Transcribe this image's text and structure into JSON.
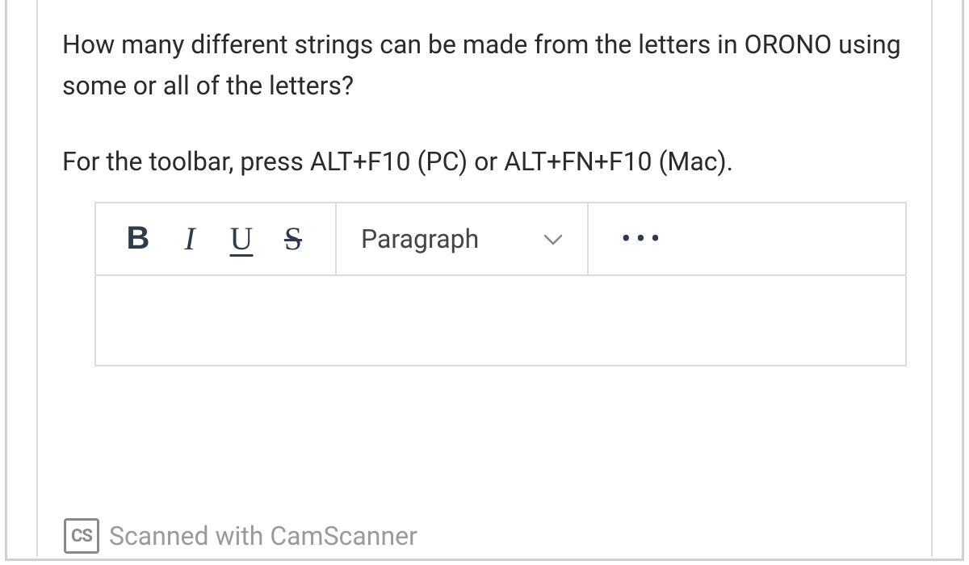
{
  "question": "How many different strings can be made from the letters in ORONO using some or all of the letters?",
  "toolbar_hint": "For the toolbar, press ALT+F10 (PC) or ALT+FN+F10 (Mac).",
  "editor": {
    "bold_label": "B",
    "italic_label": "I",
    "underline_label": "U",
    "strike_label": "S",
    "format_select": "Paragraph",
    "more_label": "•••"
  },
  "watermark": {
    "badge": "CS",
    "text": "Scanned with CamScanner"
  }
}
